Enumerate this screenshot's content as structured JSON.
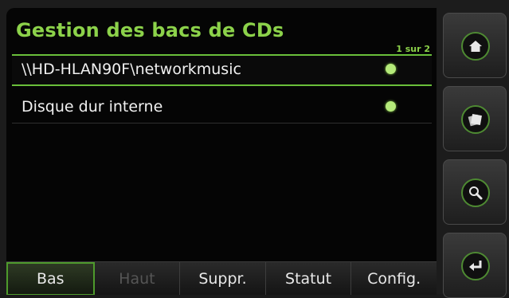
{
  "title": "Gestion des bacs de CDs",
  "page_indicator": "1 sur 2",
  "list_items": [
    {
      "label": "\\\\HD-HLAN90F\\networkmusic",
      "selected": true
    },
    {
      "label": "Disque dur interne",
      "selected": false
    }
  ],
  "bottom_buttons": [
    {
      "label": "Bas",
      "state": "active"
    },
    {
      "label": "Haut",
      "state": "disabled"
    },
    {
      "label": "Suppr.",
      "state": "normal"
    },
    {
      "label": "Statut",
      "state": "normal"
    },
    {
      "label": "Config.",
      "state": "normal"
    }
  ],
  "sidebar_buttons": [
    {
      "icon": "home-icon"
    },
    {
      "icon": "cd-library-icon"
    },
    {
      "icon": "search-icon"
    },
    {
      "icon": "enter-return-icon"
    }
  ],
  "colors": {
    "accent_green": "#8cd24a",
    "status_dot": "#b5ea7a",
    "background": "#050505",
    "text": "#f0f0f0",
    "disabled_text": "#555555"
  }
}
